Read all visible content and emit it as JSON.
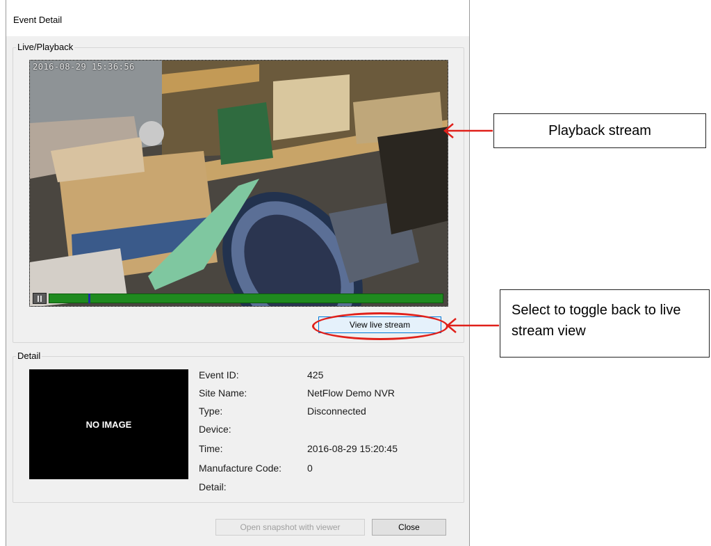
{
  "dialog": {
    "title": "Event Detail",
    "live_group_label": "Live/Playback",
    "video_timestamp": "2016-08-29 15:36:56",
    "playback_progress": 0.1,
    "view_live_label": "View live stream",
    "detail_group_label": "Detail",
    "no_image_text": "NO IMAGE",
    "details": [
      {
        "label": "Event ID:",
        "value": "425"
      },
      {
        "label": "Site Name:",
        "value": "NetFlow Demo NVR"
      },
      {
        "label": "Type:",
        "value": "Disconnected"
      },
      {
        "label": "Device:",
        "value": ""
      },
      {
        "label": "Time:",
        "value": "2016-08-29 15:20:45"
      },
      {
        "label": "Manufacture Code:",
        "value": "0"
      },
      {
        "label": "Detail:",
        "value": ""
      }
    ],
    "open_snapshot_label": "Open snapshot with viewer",
    "close_label": "Close"
  },
  "annotations": {
    "playback_callout": "Playback stream",
    "toggle_callout": "Select to toggle back to live stream view",
    "arrow_color": "#e0201a",
    "icons": [
      "pause-icon",
      "arrow-left-icon"
    ]
  }
}
